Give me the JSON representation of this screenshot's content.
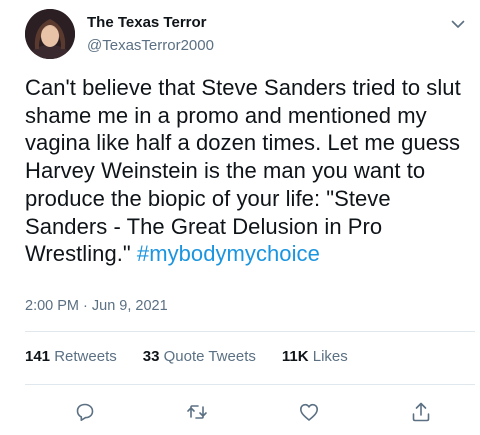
{
  "author": {
    "display_name": "The Texas Terror",
    "handle": "@TexasTerror2000"
  },
  "tweet": {
    "text": "Can't believe that Steve Sanders tried to slut shame me in a promo and mentioned my vagina like half a dozen times. Let me guess Harvey Weinstein is the man you want to produce the biopic of your life: \"Steve Sanders - The Great Delusion in Pro Wrestling.\" ",
    "hashtag": "#mybodymychoice",
    "timestamp": "2:00 PM · Jun 9, 2021"
  },
  "stats": {
    "retweets_count": "141",
    "retweets_label": "Retweets",
    "quotes_count": "33",
    "quotes_label": "Quote Tweets",
    "likes_count": "11K",
    "likes_label": "Likes"
  },
  "icons": {
    "more": "chevron-down-icon",
    "reply": "reply-icon",
    "retweet": "retweet-icon",
    "like": "heart-icon",
    "share": "share-icon"
  },
  "colors": {
    "text": "#0f1419",
    "secondary": "#5b7083",
    "link": "#1b95e0",
    "divider": "#e1e8ed"
  }
}
